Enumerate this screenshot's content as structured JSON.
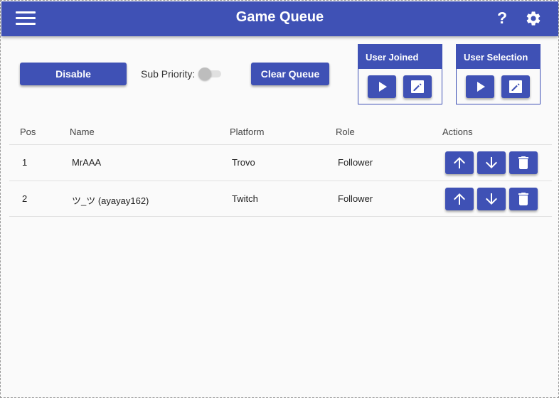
{
  "appbar": {
    "title": "Game Queue",
    "help_label": "?"
  },
  "controls": {
    "disable_label": "Disable",
    "sub_priority_label": "Sub Priority:",
    "sub_priority_on": false,
    "clear_label": "Clear Queue"
  },
  "sound_boxes": [
    {
      "title": "User Joined",
      "play_icon": "play-icon",
      "edit_icon": "edit-icon"
    },
    {
      "title": "User Selection",
      "play_icon": "play-icon",
      "edit_icon": "edit-icon"
    }
  ],
  "table": {
    "headers": [
      "Pos",
      "Name",
      "Platform",
      "Role",
      "Actions"
    ],
    "rows": [
      {
        "pos": "1",
        "name": "MrAAA",
        "platform": "Trovo",
        "role": "Follower"
      },
      {
        "pos": "2",
        "name": "ツ_ツ (ayayay162)",
        "platform": "Twitch",
        "role": "Follower"
      }
    ],
    "action_icons": [
      "arrow-up-icon",
      "arrow-down-icon",
      "trash-icon"
    ]
  },
  "colors": {
    "primary": "#3f51b5",
    "background": "#fafafa",
    "text": "#222222"
  }
}
